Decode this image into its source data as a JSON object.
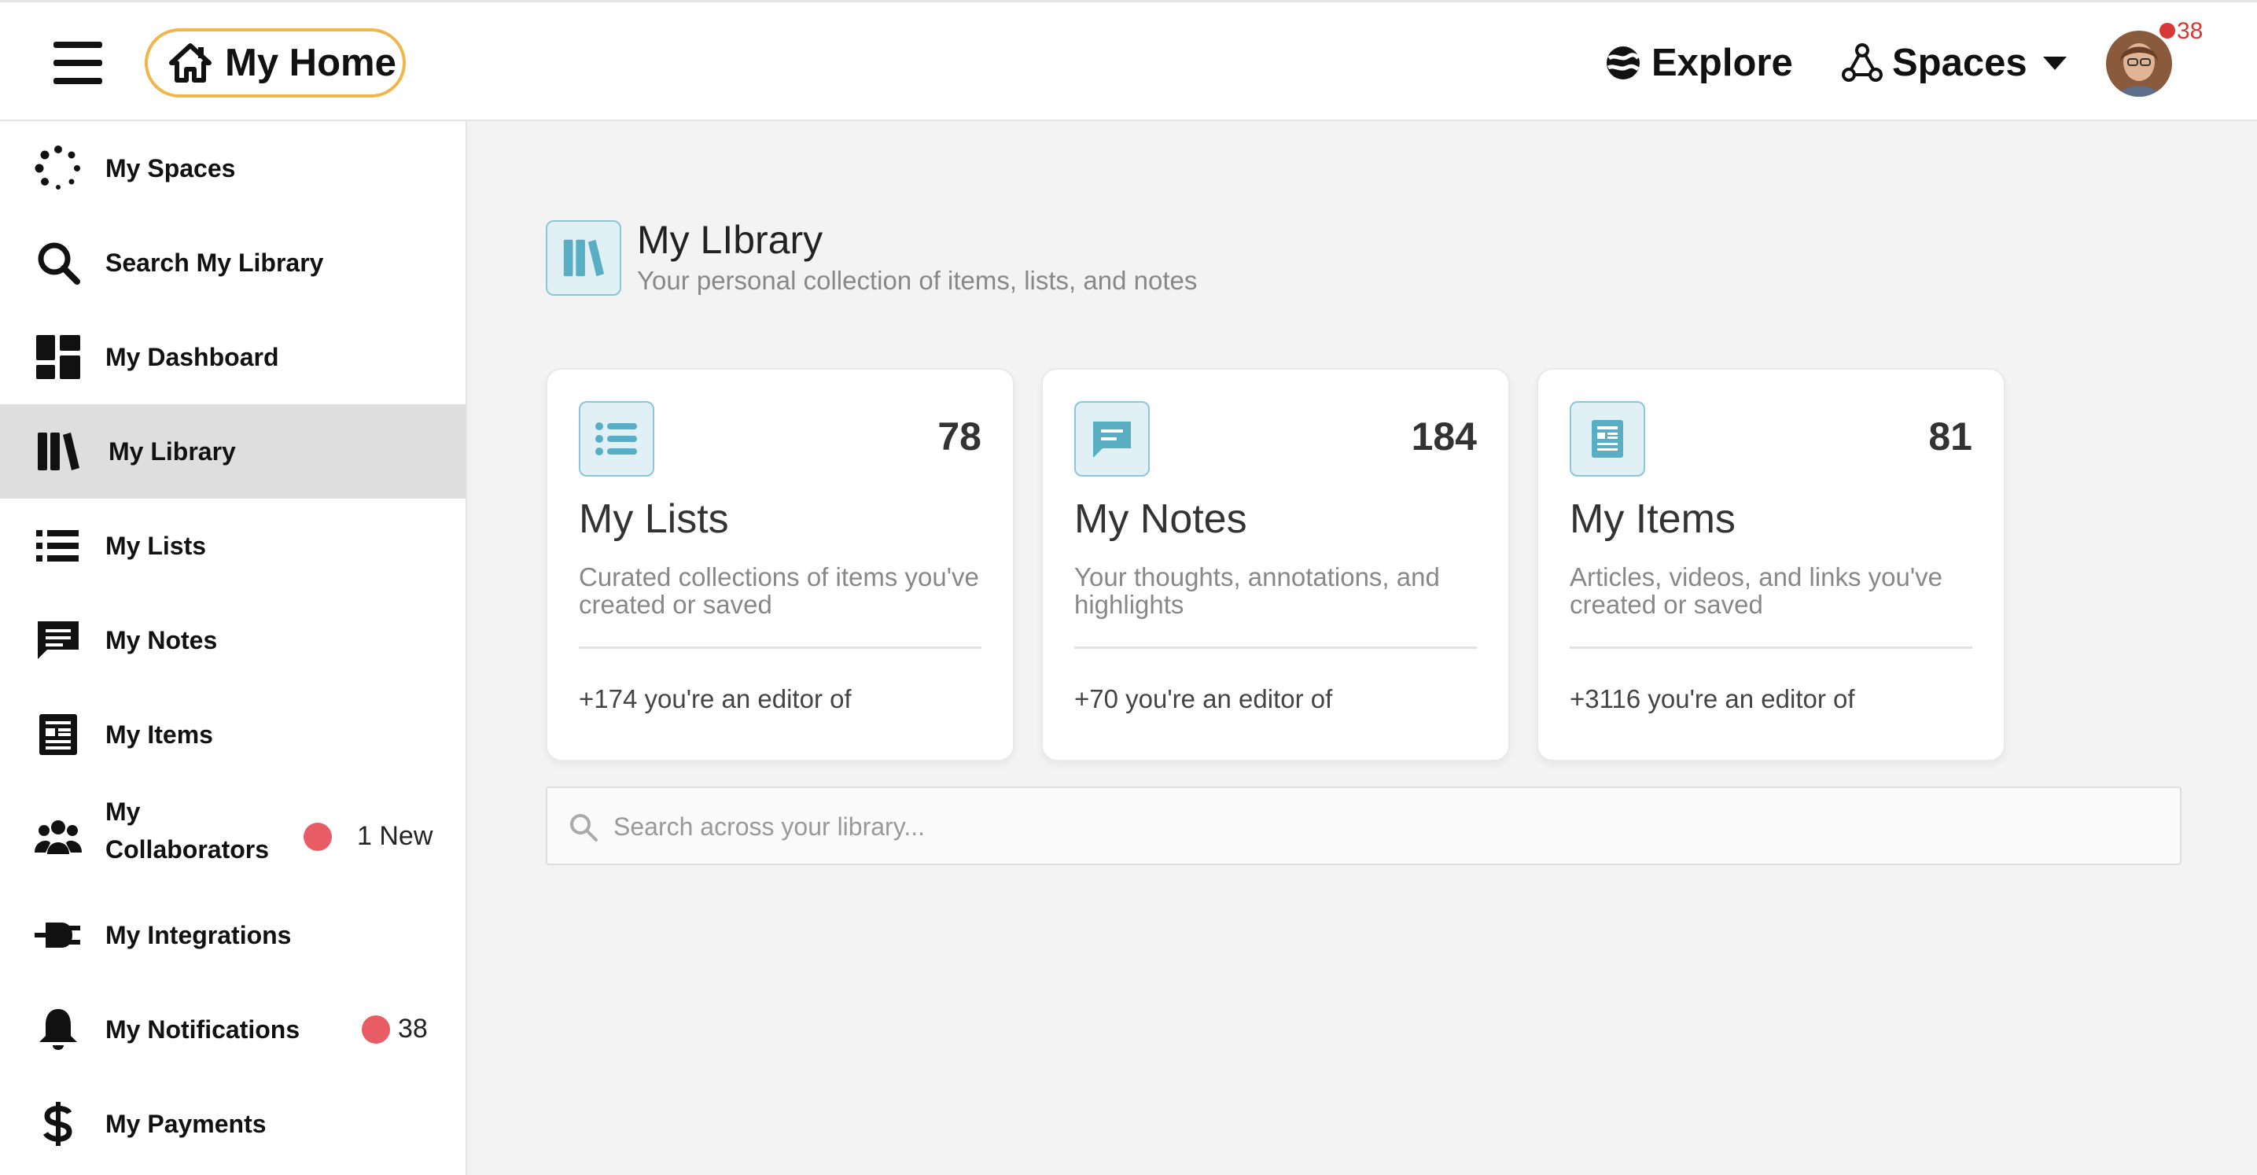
{
  "header": {
    "home_label": "My Home",
    "explore_label": "Explore",
    "spaces_label": "Spaces",
    "notification_count": "38",
    "icons": {
      "menu": "hamburger-icon",
      "home": "home-icon",
      "explore": "globe-icon",
      "spaces": "network-icon",
      "dropdown": "caret-down-icon"
    }
  },
  "sidebar": {
    "items": [
      {
        "label": "My Spaces",
        "icon": "dots-circle-icon"
      },
      {
        "label": "Search My Library",
        "icon": "search-icon"
      },
      {
        "label": "My Dashboard",
        "icon": "dashboard-icon"
      },
      {
        "label": "My Library",
        "icon": "library-icon",
        "active": true
      },
      {
        "label": "My Lists",
        "icon": "list-icon"
      },
      {
        "label": "My Notes",
        "icon": "note-icon"
      },
      {
        "label": "My Items",
        "icon": "article-icon"
      },
      {
        "label_line1": "My",
        "label_line2": "Collaborators",
        "icon": "people-icon",
        "badge": "1 New"
      },
      {
        "label": "My Integrations",
        "icon": "plug-icon"
      },
      {
        "label": "My Notifications",
        "icon": "bell-icon",
        "badge": "38"
      },
      {
        "label": "My Payments",
        "icon": "dollar-icon"
      }
    ]
  },
  "main": {
    "title": "My LIbrary",
    "subtitle": "Your personal collection of items, lists, and notes",
    "cards": [
      {
        "title": "My Lists",
        "count": "78",
        "description": "Curated collections of items you've created or saved",
        "footer": "+174 you're an editor of",
        "icon": "list-icon"
      },
      {
        "title": "My Notes",
        "count": "184",
        "description": "Your thoughts, annotations, and highlights",
        "footer": "+70 you're an editor of",
        "icon": "note-icon"
      },
      {
        "title": "My Items",
        "count": "81",
        "description": "Articles, videos, and links you've created or saved",
        "footer": "+3116 you're an editor of",
        "icon": "article-icon"
      }
    ],
    "search": {
      "placeholder": "Search across your library..."
    }
  },
  "colors": {
    "accent_border": "#f0b64a",
    "icon_teal": "#5aaec4",
    "badge_red": "#e85c66",
    "notification_red": "#d93636",
    "active_bg": "#dedede",
    "main_bg": "#f3f3f3"
  }
}
